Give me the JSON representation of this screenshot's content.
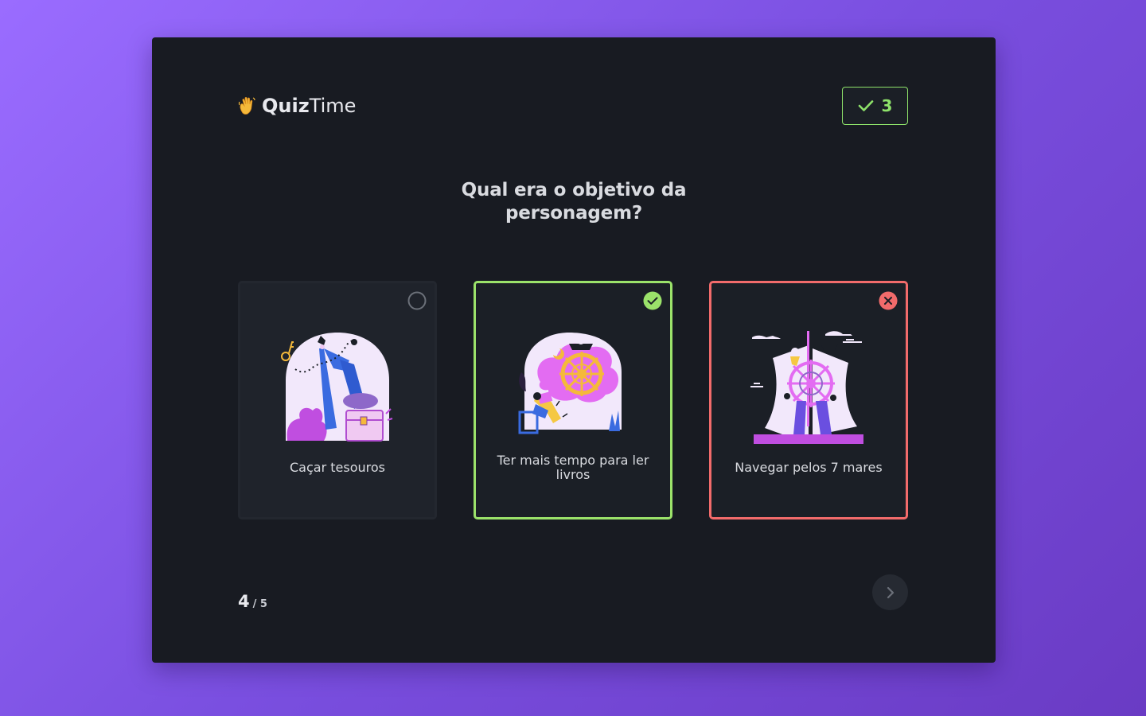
{
  "app": {
    "logo_emoji": "👋",
    "title_bold": "Quiz",
    "title_light": "Time"
  },
  "score": {
    "icon": "check-icon",
    "value": "3",
    "color": "#8ee26a"
  },
  "question": "Qual era o objetivo da personagem?",
  "options": [
    {
      "label": "Caçar tesouros",
      "state": "unselected",
      "illustration": "treasure-map-illustration"
    },
    {
      "label": "Ter mais tempo para ler livros",
      "state": "correct",
      "illustration": "reading-ship-wheel-illustration",
      "color": "#9be26a"
    },
    {
      "label": "Navegar pelos 7 mares",
      "state": "wrong",
      "illustration": "sailing-ship-illustration",
      "color": "#f26b6b"
    }
  ],
  "pager": {
    "current": "4",
    "total": "/ 5"
  },
  "next_icon": "chevron-right-icon"
}
